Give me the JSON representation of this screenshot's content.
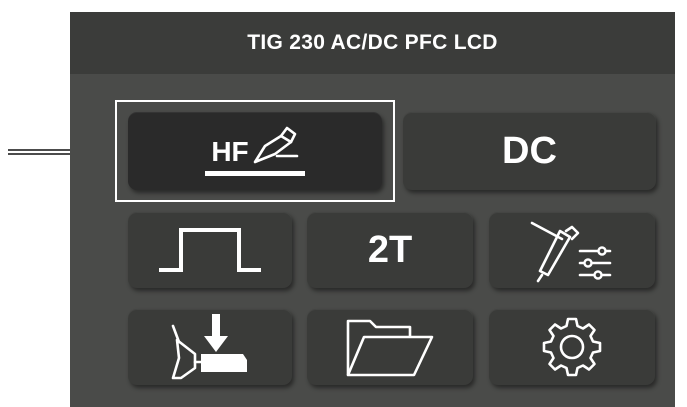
{
  "title": "TIG 230 AC/DC PFC LCD",
  "buttons": {
    "hf": {
      "label": "HF"
    },
    "dc": {
      "label": "DC"
    },
    "two_t": {
      "label": "2T"
    }
  },
  "icons": {
    "hf": "torch-icon",
    "pulse": "square-wave-icon",
    "torch_settings": "torch-settings-icon",
    "torch_down": "torch-down-arrow-icon",
    "folder": "folder-icon",
    "settings": "gear-icon"
  },
  "colors": {
    "screen_bg": "#4a4b49",
    "title_bg": "#3b3c3a",
    "button_bg": "#3a3b39",
    "selected_bg": "#2a2a2a",
    "text": "#ffffff"
  }
}
